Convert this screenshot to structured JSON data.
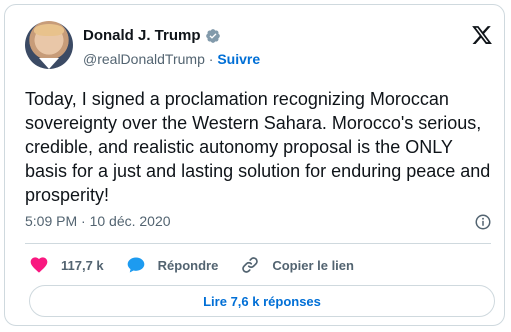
{
  "author": {
    "name": "Donald J. Trump",
    "handle": "@realDonaldTrump",
    "separator": "·",
    "follow_label": "Suivre"
  },
  "tweet": {
    "text": "Today, I signed a proclamation recognizing Moroccan sovereignty over the Western Sahara. Morocco's serious, credible, and realistic autonomy proposal is the ONLY basis for a just and lasting solution for enduring peace and prosperity!",
    "timestamp": "5:09 PM · 10 déc. 2020"
  },
  "actions": {
    "likes": "117,7 k",
    "reply_label": "Répondre",
    "copy_link_label": "Copier le lien"
  },
  "read_replies_label": "Lire 7,6 k réponses",
  "colors": {
    "accent": "#006fd6",
    "like": "#f91880",
    "verified": "#829aab",
    "text": "#0f1419",
    "muted": "#536471",
    "border": "#cfd9de"
  },
  "icons": [
    "verified-badge-icon",
    "x-logo-icon",
    "info-icon",
    "heart-icon",
    "reply-bubble-icon",
    "link-icon"
  ]
}
